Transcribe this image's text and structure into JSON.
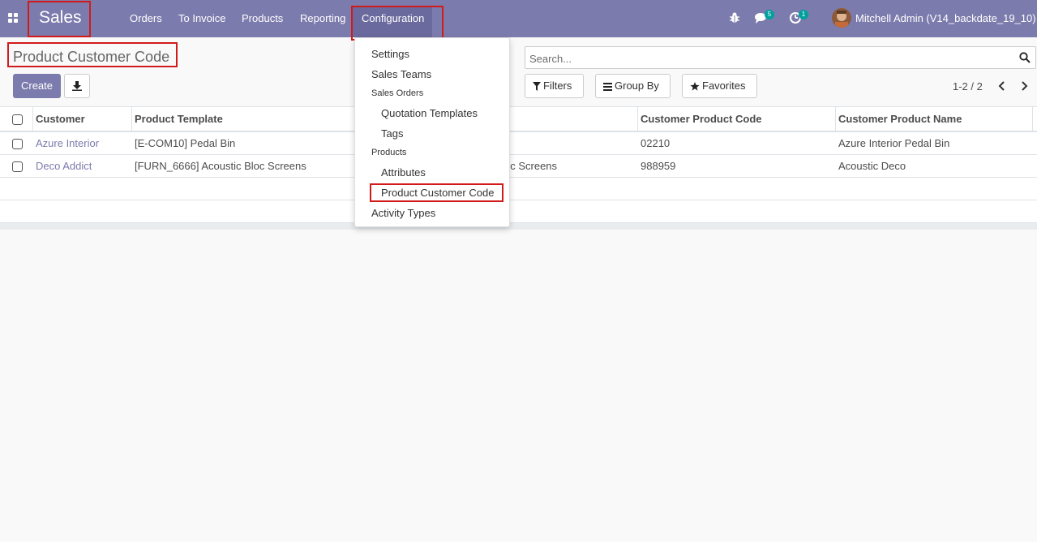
{
  "navbar": {
    "brand": "Sales",
    "menu": [
      "Orders",
      "To Invoice",
      "Products",
      "Reporting",
      "Configuration"
    ],
    "messages_count": "5",
    "activities_count": "1",
    "user": "Mitchell Admin (V14_backdate_19_10)",
    "color": "#7c7bad"
  },
  "page": {
    "title": "Product Customer Code",
    "create_label": "Create"
  },
  "search": {
    "placeholder": "Search...",
    "filters": "Filters",
    "group_by": "Group By",
    "favorites": "Favorites",
    "pager": "1-2 / 2"
  },
  "table": {
    "headers": [
      "Customer",
      "Product Template",
      "Customer Product Code",
      "Customer Product Name"
    ],
    "rows": [
      {
        "customer": "Azure Interior",
        "template": "[E-COM10] Pedal Bin",
        "variant": "",
        "code": "02210",
        "name": "Azure Interior Pedal Bin"
      },
      {
        "customer": "Deco Addict",
        "template": "[FURN_6666] Acoustic Bloc Screens",
        "variant": "oc Screens",
        "code": "988959",
        "name": "Acoustic Deco"
      }
    ]
  },
  "dropdown": {
    "settings": "Settings",
    "sales_teams": "Sales Teams",
    "sales_orders_header": "Sales Orders",
    "quotation_templates": "Quotation Templates",
    "tags": "Tags",
    "products_header": "Products",
    "attributes": "Attributes",
    "product_customer_code": "Product Customer Code",
    "activity_types": "Activity Types"
  }
}
